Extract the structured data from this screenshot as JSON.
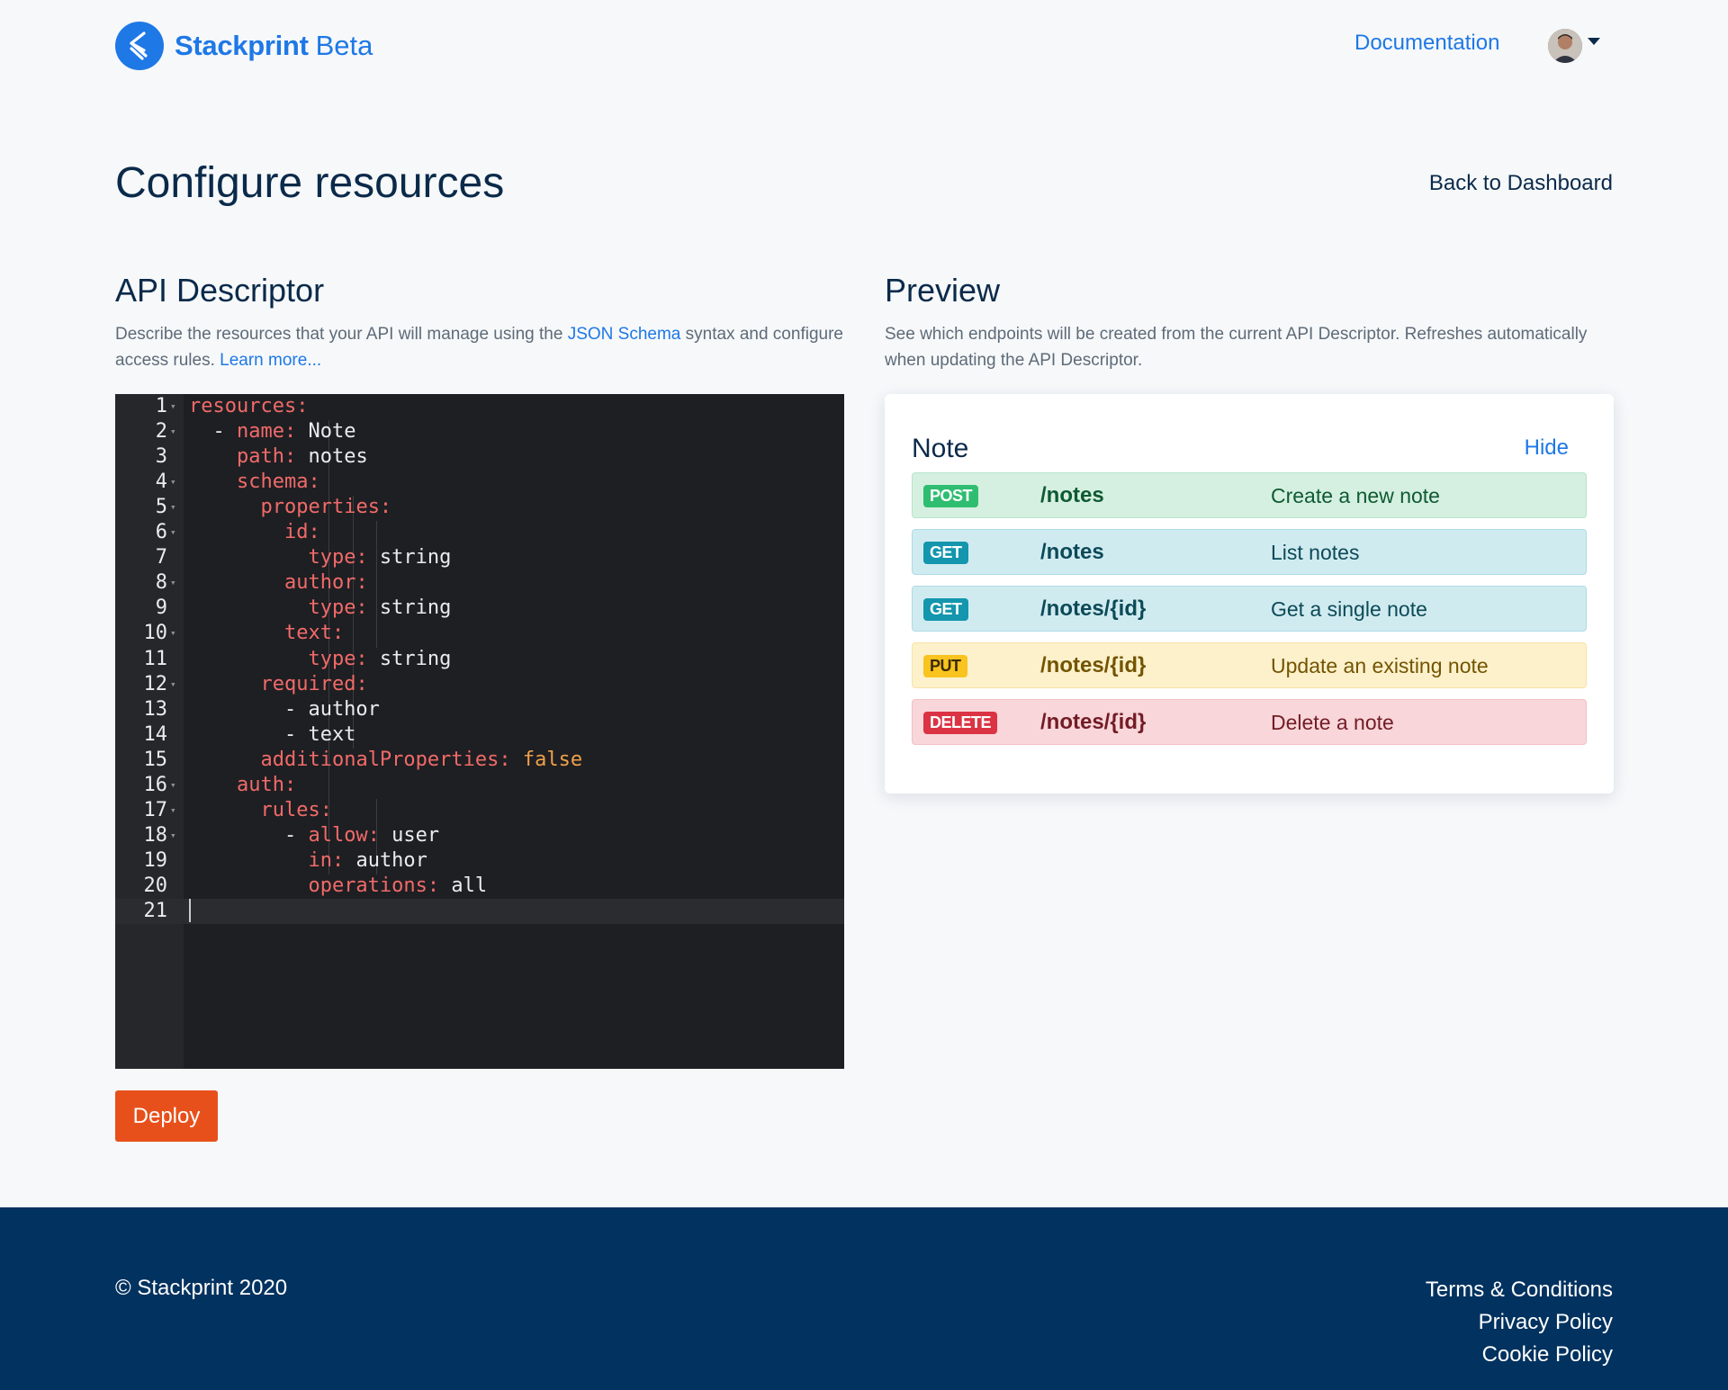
{
  "header": {
    "brand_name": "Stackprint",
    "brand_beta": "Beta",
    "nav_documentation": "Documentation"
  },
  "page": {
    "title": "Configure resources",
    "back_link": "Back to Dashboard"
  },
  "descriptor": {
    "title": "API Descriptor",
    "desc_before": "Describe the resources that your API will manage using the ",
    "desc_link": "JSON Schema",
    "desc_after": " syntax and configure access rules. ",
    "learn_more": "Learn more...",
    "deploy_label": "Deploy",
    "lines": [
      {
        "n": "1",
        "fold": true,
        "parts": [
          [
            "k",
            "resources:"
          ]
        ]
      },
      {
        "n": "2",
        "fold": true,
        "parts": [
          [
            "p",
            "  - "
          ],
          [
            "k",
            "name:"
          ],
          [
            "p",
            " Note"
          ]
        ]
      },
      {
        "n": "3",
        "fold": false,
        "parts": [
          [
            "p",
            "    "
          ],
          [
            "k",
            "path:"
          ],
          [
            "p",
            " notes"
          ]
        ]
      },
      {
        "n": "4",
        "fold": true,
        "parts": [
          [
            "p",
            "    "
          ],
          [
            "k",
            "schema:"
          ]
        ]
      },
      {
        "n": "5",
        "fold": true,
        "parts": [
          [
            "p",
            "      "
          ],
          [
            "k",
            "properties:"
          ]
        ]
      },
      {
        "n": "6",
        "fold": true,
        "parts": [
          [
            "p",
            "        "
          ],
          [
            "k",
            "id:"
          ]
        ]
      },
      {
        "n": "7",
        "fold": false,
        "parts": [
          [
            "p",
            "          "
          ],
          [
            "k",
            "type:"
          ],
          [
            "p",
            " string"
          ]
        ]
      },
      {
        "n": "8",
        "fold": true,
        "parts": [
          [
            "p",
            "        "
          ],
          [
            "k",
            "author:"
          ]
        ]
      },
      {
        "n": "9",
        "fold": false,
        "parts": [
          [
            "p",
            "          "
          ],
          [
            "k",
            "type:"
          ],
          [
            "p",
            " string"
          ]
        ]
      },
      {
        "n": "10",
        "fold": true,
        "parts": [
          [
            "p",
            "        "
          ],
          [
            "k",
            "text:"
          ]
        ]
      },
      {
        "n": "11",
        "fold": false,
        "parts": [
          [
            "p",
            "          "
          ],
          [
            "k",
            "type:"
          ],
          [
            "p",
            " string"
          ]
        ]
      },
      {
        "n": "12",
        "fold": true,
        "parts": [
          [
            "p",
            "      "
          ],
          [
            "k",
            "required:"
          ]
        ]
      },
      {
        "n": "13",
        "fold": false,
        "parts": [
          [
            "p",
            "        - author"
          ]
        ]
      },
      {
        "n": "14",
        "fold": false,
        "parts": [
          [
            "p",
            "        - text"
          ]
        ]
      },
      {
        "n": "15",
        "fold": false,
        "parts": [
          [
            "p",
            "      "
          ],
          [
            "k",
            "additionalProperties:"
          ],
          [
            "b",
            " false"
          ]
        ]
      },
      {
        "n": "16",
        "fold": true,
        "parts": [
          [
            "p",
            "    "
          ],
          [
            "k",
            "auth:"
          ]
        ]
      },
      {
        "n": "17",
        "fold": true,
        "parts": [
          [
            "p",
            "      "
          ],
          [
            "k",
            "rules:"
          ]
        ]
      },
      {
        "n": "18",
        "fold": true,
        "parts": [
          [
            "p",
            "        - "
          ],
          [
            "k",
            "allow:"
          ],
          [
            "p",
            " user"
          ]
        ]
      },
      {
        "n": "19",
        "fold": false,
        "parts": [
          [
            "p",
            "          "
          ],
          [
            "k",
            "in:"
          ],
          [
            "p",
            " author"
          ]
        ]
      },
      {
        "n": "20",
        "fold": false,
        "parts": [
          [
            "p",
            "          "
          ],
          [
            "k",
            "operations:"
          ],
          [
            "p",
            " all"
          ]
        ]
      },
      {
        "n": "21",
        "fold": false,
        "parts": []
      }
    ]
  },
  "preview": {
    "title": "Preview",
    "description": "See which endpoints will be created from the current API Descriptor. Refreshes automatically when updating the API Descriptor.",
    "resource_name": "Note",
    "hide_label": "Hide",
    "endpoints": [
      {
        "method": "POST",
        "path": "/notes",
        "desc": "Create a new note"
      },
      {
        "method": "GET",
        "path": "/notes",
        "desc": "List notes"
      },
      {
        "method": "GET",
        "path": "/notes/{id}",
        "desc": "Get a single note"
      },
      {
        "method": "PUT",
        "path": "/notes/{id}",
        "desc": "Update an existing note"
      },
      {
        "method": "DELETE",
        "path": "/notes/{id}",
        "desc": "Delete a note"
      }
    ]
  },
  "footer": {
    "copyright": "© Stackprint 2020",
    "links": [
      "Terms & Conditions",
      "Privacy Policy",
      "Cookie Policy"
    ]
  },
  "colors": {
    "brand": "#1e78e6",
    "deploy": "#e8501b",
    "footer_bg": "#02325f",
    "editor_bg": "#1e1f22"
  },
  "icons": {
    "logo": "stackprint-logo-icon",
    "avatar_caret": "chevron-down-icon"
  }
}
